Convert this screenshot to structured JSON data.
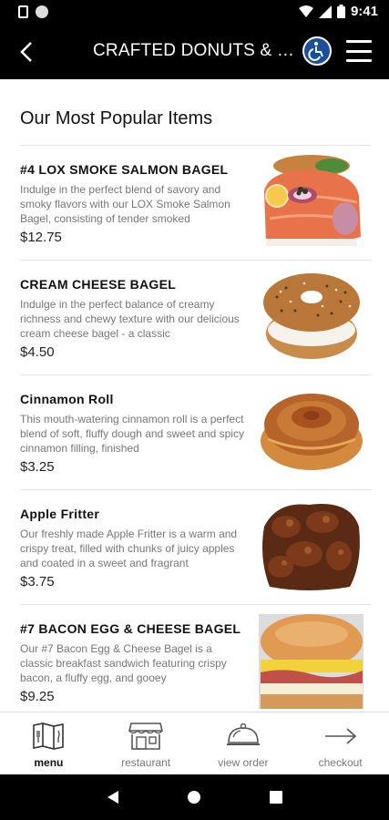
{
  "status_bar": {
    "time": "9:41"
  },
  "header": {
    "title": "CRAFTED DONUTS & BAGELS"
  },
  "section": {
    "title": "Our Most Popular Items"
  },
  "items": [
    {
      "name": "#4 LOX SMOKE SALMON BAGEL",
      "description": "Indulge in the perfect blend of savory and smoky flavors with our LOX Smoke Salmon Bagel, consisting of tender smoked",
      "price": "$12.75"
    },
    {
      "name": "CREAM CHEESE BAGEL",
      "description": "Indulge in the perfect balance of creamy richness and chewy texture with our delicious cream cheese bagel - a classic",
      "price": "$4.50"
    },
    {
      "name": "Cinnamon Roll",
      "description": "This mouth-watering cinnamon roll is a perfect blend of soft, fluffy dough and sweet and spicy cinnamon filling, finished",
      "price": "$3.25"
    },
    {
      "name": "Apple Fritter",
      "description": "Our freshly made Apple Fritter is a warm and crispy treat, filled with chunks of juicy apples and coated in a sweet and fragrant",
      "price": "$3.75"
    },
    {
      "name": "#7 BACON EGG & CHEESE BAGEL",
      "description": "Our #7 Bacon Egg & Cheese Bagel is a classic breakfast sandwich featuring crispy bacon, a fluffy egg, and gooey",
      "price": "$9.25"
    }
  ],
  "bottom_nav": {
    "menu": "menu",
    "restaurant": "restaurant",
    "view_order": "view order",
    "checkout": "checkout"
  },
  "colors": {
    "accessibility": "#1b4f9c",
    "header_bg": "#000000",
    "description": "#777777"
  }
}
